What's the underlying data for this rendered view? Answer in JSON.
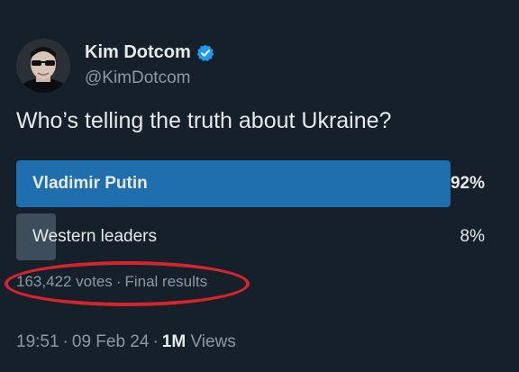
{
  "author": {
    "name": "Kim Dotcom",
    "handle": "@KimDotcom"
  },
  "tweet": {
    "question": "Who’s telling the truth about Ukraine?"
  },
  "poll": {
    "options": [
      {
        "label": "Vladimir Putin",
        "percent": "92%",
        "fraction": 0.92,
        "winner": true
      },
      {
        "label": "Western leaders",
        "percent": "8%",
        "fraction": 0.08,
        "winner": false
      }
    ],
    "votes": "163,422 votes",
    "separator": "·",
    "status": "Final results"
  },
  "meta": {
    "time": "19:51",
    "date": "09 Feb 24",
    "separator": "·",
    "views_count": "1M",
    "views_label": "Views"
  },
  "colors": {
    "background": "#15202b",
    "winner_bar": "#1f6fae",
    "loser_bar": "#3d4d5c",
    "verified": "#1d9bf0",
    "highlight": "#d6242c"
  }
}
